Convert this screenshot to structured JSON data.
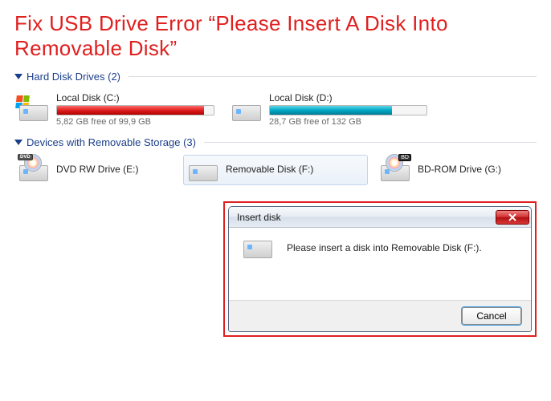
{
  "headline": "Fix USB Drive Error “Please Insert A Disk Into Removable Disk”",
  "sections": {
    "hdd": {
      "title": "Hard Disk Drives (2)"
    },
    "removable": {
      "title": "Devices with Removable Storage (3)"
    }
  },
  "hdd_drives": [
    {
      "name": "Local Disk (C:)",
      "stats": "5,82 GB free of 99,9 GB"
    },
    {
      "name": "Local Disk (D:)",
      "stats": "28,7 GB free of 132 GB"
    }
  ],
  "removable_drives": [
    {
      "name": "DVD RW Drive (E:)"
    },
    {
      "name": "Removable Disk (F:)"
    },
    {
      "name": "BD-ROM Drive (G:)"
    }
  ],
  "dialog": {
    "title": "Insert disk",
    "message": "Please insert a disk into Removable Disk (F:).",
    "cancel": "Cancel"
  }
}
